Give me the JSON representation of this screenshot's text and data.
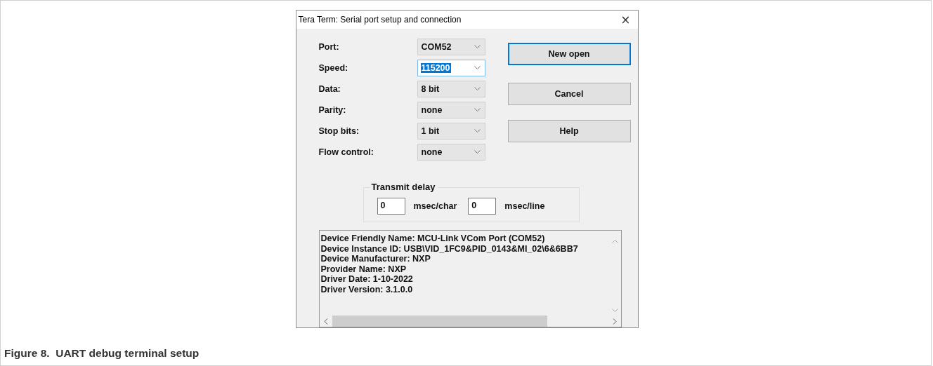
{
  "window": {
    "title": "Tera Term: Serial port setup and connection",
    "close": "×"
  },
  "fields": [
    {
      "label": "Port:",
      "value": "COM52",
      "selected": false
    },
    {
      "label": "Speed:",
      "value": "115200",
      "selected": true
    },
    {
      "label": "Data:",
      "value": "8 bit",
      "selected": false
    },
    {
      "label": "Parity:",
      "value": "none",
      "selected": false
    },
    {
      "label": "Stop bits:",
      "value": "1 bit",
      "selected": false
    },
    {
      "label": "Flow control:",
      "value": "none",
      "selected": false
    }
  ],
  "buttons": [
    {
      "label": "New open",
      "default": true
    },
    {
      "label": "Cancel",
      "default": false
    },
    {
      "label": "Help",
      "default": false
    }
  ],
  "transmit_delay": {
    "title": "Transmit delay",
    "fields": [
      {
        "value": "0",
        "unit": "msec/char"
      },
      {
        "value": "0",
        "unit": "msec/line"
      }
    ]
  },
  "device_info": [
    "Device Friendly Name: MCU-Link VCom Port (COM52)",
    "Device Instance ID: USB\\VID_1FC9&PID_0143&MI_02\\6&6BB7",
    "Device Manufacturer: NXP",
    "Provider Name: NXP",
    "Driver Date: 1-10-2022",
    "Driver Version: 3.1.0.0"
  ],
  "caption": "Figure 8.  UART debug terminal setup"
}
